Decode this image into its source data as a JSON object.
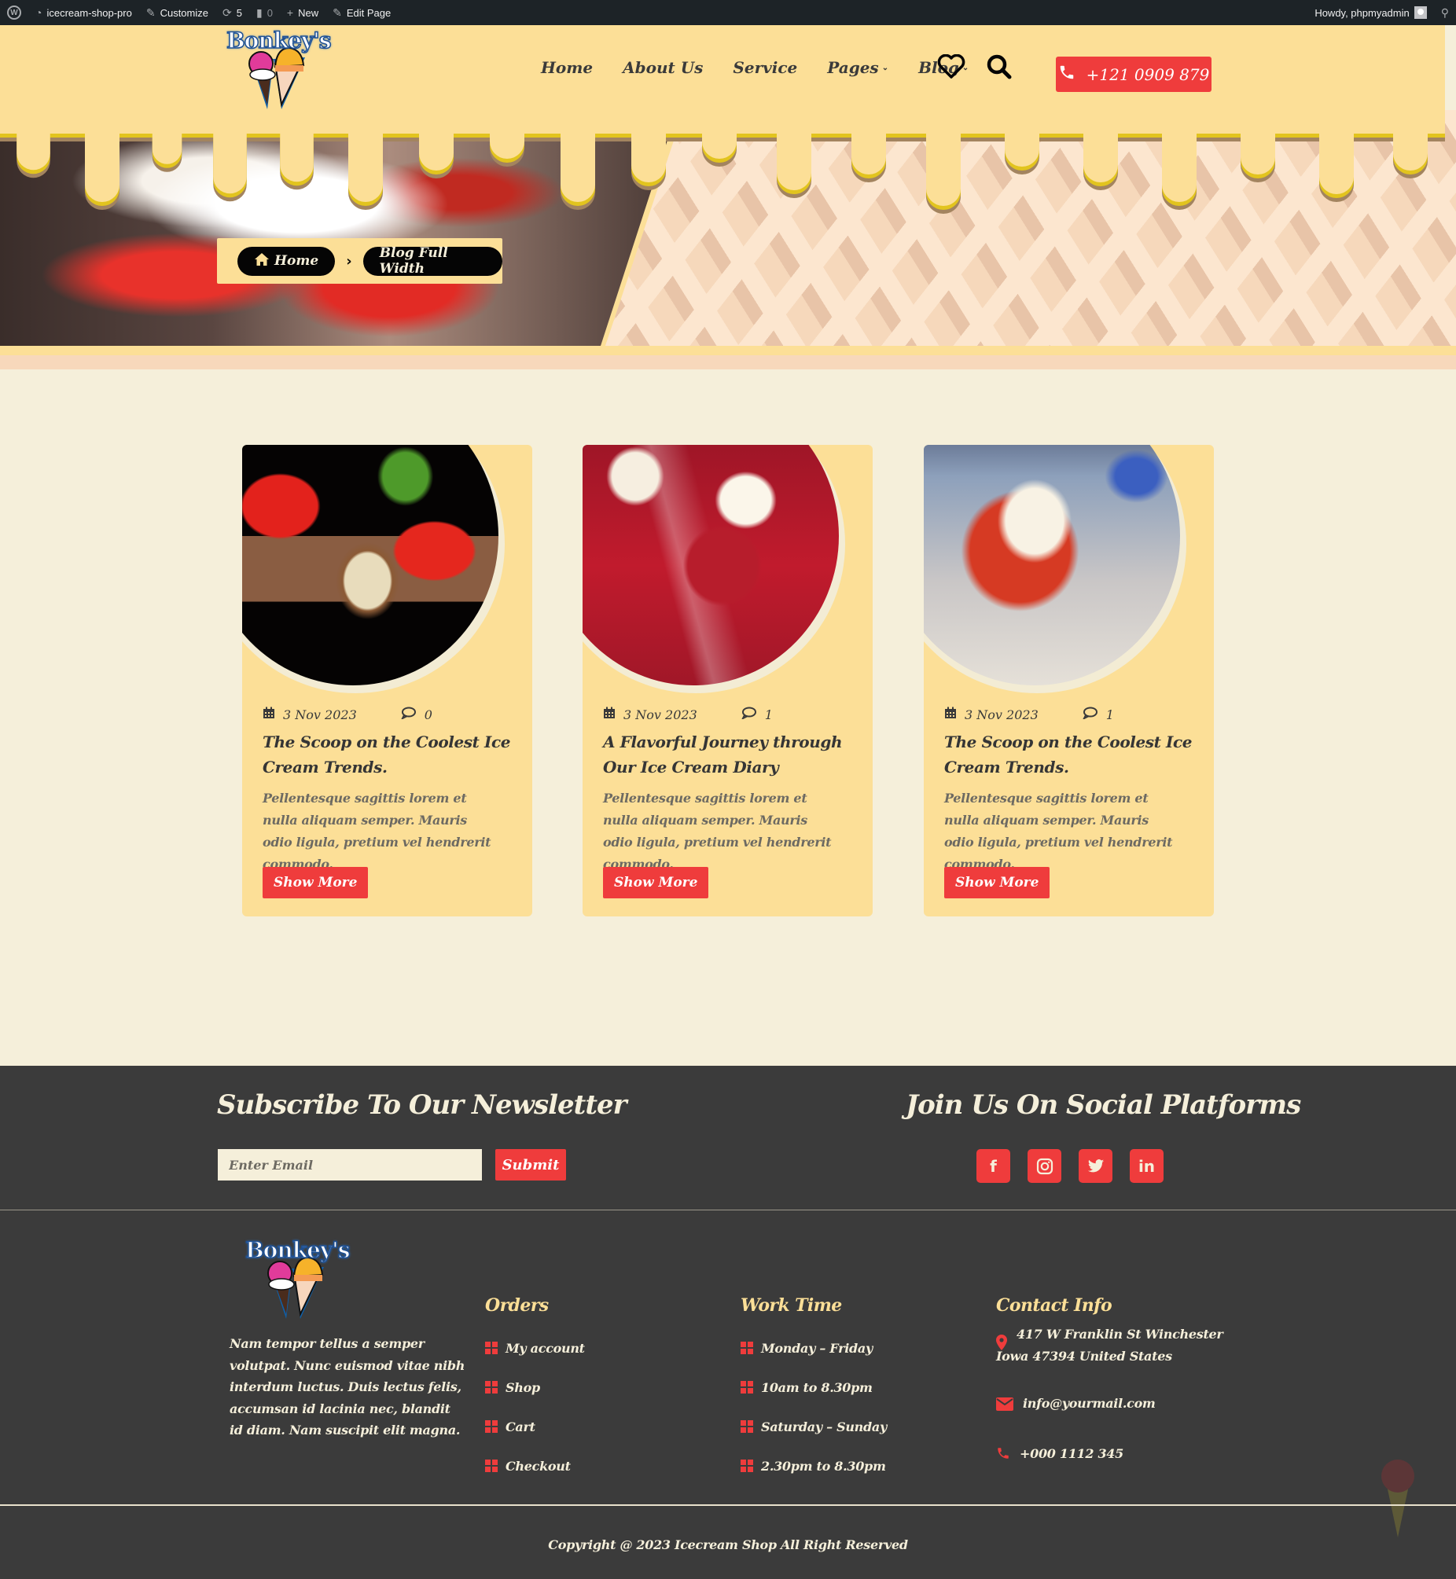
{
  "admin_bar": {
    "site_name": "icecream-shop-pro",
    "customize": "Customize",
    "updates_count": "5",
    "comments_count": "0",
    "new": "New",
    "edit_page": "Edit Page",
    "greeting": "Howdy, phpmyadmin"
  },
  "header": {
    "logo_text": "Bonkey's",
    "nav": [
      {
        "label": "Home",
        "has_dropdown": false
      },
      {
        "label": "About Us",
        "has_dropdown": false
      },
      {
        "label": "Service",
        "has_dropdown": false
      },
      {
        "label": "Pages",
        "has_dropdown": true
      },
      {
        "label": "Blog",
        "has_dropdown": true
      }
    ],
    "phone": "+121 0909 879"
  },
  "breadcrumb": {
    "home": "Home",
    "current": "Blog Full Width"
  },
  "posts": [
    {
      "date": "3 Nov 2023",
      "comments": "0",
      "title": "The Scoop on the Coolest Ice Cream Trends.",
      "excerpt": "Pellentesque sagittis lorem et nulla aliquam semper. Mauris odio ligula, pretium vel hendrerit commodo.",
      "button": "Show More"
    },
    {
      "date": "3 Nov 2023",
      "comments": "1",
      "title": "A Flavorful Journey through Our Ice Cream Diary",
      "excerpt": "Pellentesque sagittis lorem et nulla aliquam semper. Mauris odio ligula, pretium vel hendrerit commodo.",
      "button": "Show More"
    },
    {
      "date": "3 Nov 2023",
      "comments": "1",
      "title": "The Scoop on the Coolest Ice Cream Trends.",
      "excerpt": "Pellentesque sagittis lorem et nulla aliquam semper. Mauris odio ligula, pretium vel hendrerit commodo.",
      "button": "Show More"
    }
  ],
  "newsletter": {
    "title": "Subscribe To Our Newsletter",
    "placeholder": "Enter Email",
    "submit": "Submit"
  },
  "social": {
    "title": "Join Us On Social Platforms",
    "icons": [
      "facebook-icon",
      "instagram-icon",
      "twitter-icon",
      "linkedin-icon"
    ]
  },
  "footer": {
    "logo_text": "Bonkey's",
    "about": "Nam tempor tellus a semper volutpat. Nunc euismod vitae nibh interdum luctus. Duis lectus felis, accumsan id lacinia nec, blandit id diam. Nam suscipit elit magna.",
    "orders": {
      "title": "Orders",
      "items": [
        "My account",
        "Shop",
        "Cart",
        "Checkout"
      ]
    },
    "work_time": {
      "title": "Work Time",
      "items": [
        "Monday – Friday",
        "10am to 8.30pm",
        "Saturday – Sunday",
        "2.30pm to 8.30pm"
      ]
    },
    "contact": {
      "title": "Contact Info",
      "address": "417 W Franklin St Winchester Iowa 47394 United States",
      "email": "info@yourmail.com",
      "phone": "+000 1112 345"
    },
    "copyright": "Copyright @ 2023 Icecream Shop All Right Reserved"
  },
  "colors": {
    "header_bg": "#fcdf97",
    "accent_red": "#ef3c3c",
    "page_bg": "#f5efda",
    "footer_bg": "#3b3b3b",
    "admin_bar_bg": "#1d2327"
  }
}
